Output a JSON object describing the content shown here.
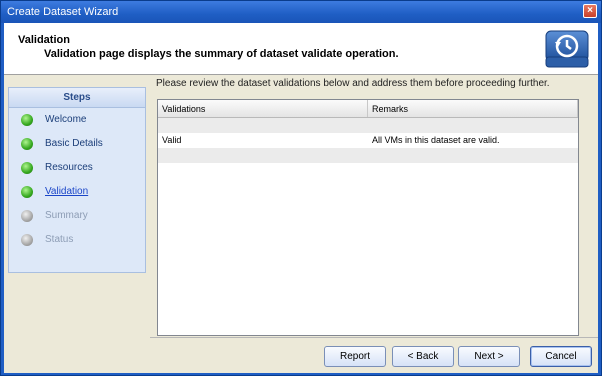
{
  "window": {
    "title": "Create Dataset Wizard",
    "close_label": "×"
  },
  "header": {
    "title": "Validation",
    "description": "Validation page displays the summary of dataset validate operation.",
    "logo_icon": "restore-drive-icon"
  },
  "steps": {
    "heading": "Steps",
    "items": [
      {
        "label": "Welcome",
        "state": "done"
      },
      {
        "label": "Basic Details",
        "state": "done"
      },
      {
        "label": "Resources",
        "state": "done"
      },
      {
        "label": "Validation",
        "state": "current"
      },
      {
        "label": "Summary",
        "state": "pending"
      },
      {
        "label": "Status",
        "state": "pending"
      }
    ]
  },
  "main": {
    "intro": "Please review the dataset validations below and address them before proceeding further.",
    "table": {
      "headers": [
        "Validations",
        "Remarks"
      ],
      "rows": [
        [
          "Valid",
          "All VMs in this dataset are valid."
        ]
      ]
    }
  },
  "buttons": {
    "report": "Report",
    "back": "< Back",
    "next": "Next >",
    "cancel": "Cancel"
  },
  "colors": {
    "titlebar": "#1f5ec4",
    "done_dot": "#35a81f",
    "pending_dot": "#a8a8a8",
    "link": "#1a45c8"
  }
}
